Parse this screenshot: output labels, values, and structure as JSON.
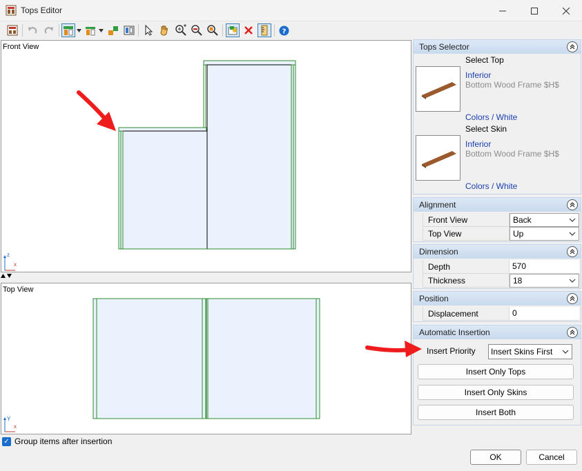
{
  "window": {
    "title": "Tops Editor"
  },
  "icons": {
    "app": "tops-editor-app-icon",
    "undo": "undo-icon",
    "redo": "redo-icon",
    "select": "pointer-icon",
    "pan": "hand-icon",
    "zoom_in": "zoom-in-icon",
    "zoom_out": "zoom-out-icon",
    "zoom_fit": "zoom-fit-icon",
    "delete": "delete-icon",
    "help": "help-icon"
  },
  "views": {
    "front_label": "Front View",
    "top_label": "Top View",
    "front_axes": {
      "v": "z",
      "h": "x"
    },
    "top_axes": {
      "v": "Y",
      "h": "x"
    }
  },
  "group_items": {
    "label": "Group items after insertion",
    "checked": true
  },
  "tops_selector": {
    "title": "Tops Selector",
    "select_top": "Select Top",
    "top_link": "Inferior",
    "top_desc": "Bottom Wood Frame $H$",
    "top_color": "Colors / White",
    "select_skin": "Select Skin",
    "skin_link": "Inferior",
    "skin_desc": "Bottom Wood Frame $H$",
    "skin_color": "Colors / White"
  },
  "alignment": {
    "title": "Alignment",
    "front_view_label": "Front View",
    "front_view_value": "Back",
    "top_view_label": "Top View",
    "top_view_value": "Up"
  },
  "dimension": {
    "title": "Dimension",
    "depth_label": "Depth",
    "depth_value": "570",
    "thickness_label": "Thickness",
    "thickness_value": "18"
  },
  "position": {
    "title": "Position",
    "displacement_label": "Displacement",
    "displacement_value": "0"
  },
  "automatic_insertion": {
    "title": "Automatic Insertion",
    "priority_label": "Insert Priority",
    "priority_value": "Insert Skins First",
    "insert_only_tops": "Insert Only Tops",
    "insert_only_skins": "Insert Only Skins",
    "insert_both": "Insert Both"
  },
  "dialog": {
    "ok": "OK",
    "cancel": "Cancel"
  },
  "colors": {
    "accent": "#1a6dcc",
    "frame_green": "#2e8b2e",
    "panel_fill": "#eaf2fd",
    "annotation_red": "#ee1c1c",
    "link_blue": "#1a3fb0"
  }
}
